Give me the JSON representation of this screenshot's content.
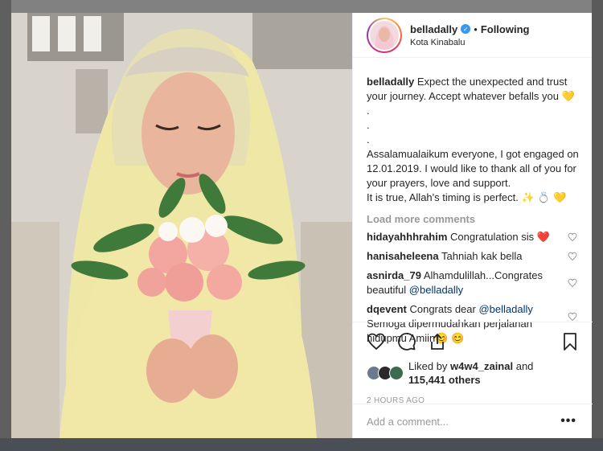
{
  "post": {
    "username": "belladally",
    "follow_status": "Following",
    "separator": "•",
    "location": "Kota Kinabalu"
  },
  "caption": {
    "username": "belladally",
    "line1": "Expect the unexpected and trust your journey. Accept whatever befalls you 💛",
    "dot1": ".",
    "dot2": ".",
    "dot3": ".",
    "line2": "Assalamualaikum everyone, I got engaged on 12.01.2019. I would like to thank all of you for your prayers, love and support.",
    "line3": "It is true, Allah's timing is perfect. ✨ 💍 💛"
  },
  "load_more": "Load more comments",
  "comments": [
    {
      "username": "hidayahhhrahim",
      "text": "Congratulation sis ❤️",
      "mention": ""
    },
    {
      "username": "hanisaheleena",
      "text": "Tahniah kak bella",
      "mention": ""
    },
    {
      "username": "asnirda_79",
      "text": "Alhamdulillah...Congrates beautiful",
      "mention": "@belladally"
    },
    {
      "username": "dqevent",
      "text": "Congrats dear",
      "mention": "@belladally",
      "text2": "Semoga dipermudahkan perjalanan hidupmu Amiin😊 😊"
    }
  ],
  "likes": {
    "prefix": "Liked by",
    "user": "w4w4_zainal",
    "and": "and",
    "count": "115,441 others"
  },
  "timestamp": "2 HOURS AGO",
  "add_comment": {
    "placeholder": "Add a comment..."
  },
  "more_options": "•••",
  "icons": [
    "heart-icon",
    "comment-icon",
    "share-icon",
    "bookmark-icon",
    "verified-icon",
    "more-icon"
  ],
  "colors": {
    "verified": "#3897f0",
    "mention": "#003569",
    "muted": "#999999",
    "text": "#262626"
  }
}
